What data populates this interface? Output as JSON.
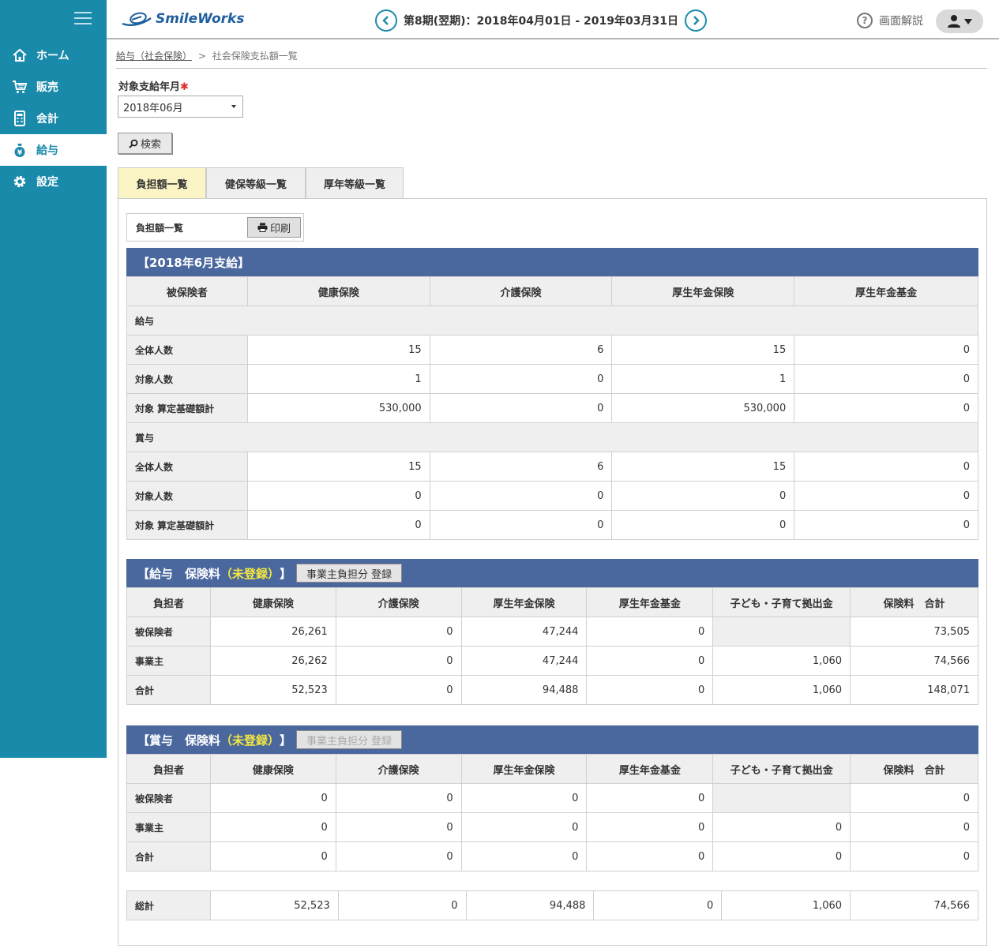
{
  "app": {
    "logo_text": "SmileWorks"
  },
  "sidebar": {
    "items": [
      {
        "label": "ホーム",
        "icon": "home-icon"
      },
      {
        "label": "販売",
        "icon": "cart-icon"
      },
      {
        "label": "会計",
        "icon": "calculator-icon"
      },
      {
        "label": "給与",
        "icon": "money-bag-icon",
        "active": true
      },
      {
        "label": "設定",
        "icon": "gear-icon"
      }
    ]
  },
  "header": {
    "period": "第8期(翌期)：2018年04月01日 - 2019年03月31日",
    "help_label": "画面解説"
  },
  "breadcrumb": {
    "parent": "給与（社会保険）",
    "separator": ">",
    "current": "社会保険支払額一覧"
  },
  "form": {
    "label": "対象支給年月",
    "required_mark": "✱",
    "selected_month": "2018年06月",
    "search_label": "検索"
  },
  "tabs": [
    {
      "label": "負担額一覧",
      "active": true
    },
    {
      "label": "健保等級一覧"
    },
    {
      "label": "厚年等級一覧"
    }
  ],
  "panel": {
    "title": "負担額一覧",
    "print_label": "印刷"
  },
  "summary": {
    "title": "【2018年6月支給】",
    "headers": [
      "被保険者",
      "健康保険",
      "介護保険",
      "厚生年金保険",
      "厚生年金基金"
    ],
    "groups": [
      {
        "name": "給与",
        "rows": [
          {
            "label": "全体人数",
            "values": [
              "15",
              "6",
              "15",
              "0"
            ]
          },
          {
            "label": "対象人数",
            "values": [
              "1",
              "0",
              "1",
              "0"
            ]
          },
          {
            "label": "対象 算定基礎額計",
            "values": [
              "530,000",
              "0",
              "530,000",
              "0"
            ]
          }
        ]
      },
      {
        "name": "賞与",
        "rows": [
          {
            "label": "全体人数",
            "values": [
              "15",
              "6",
              "15",
              "0"
            ]
          },
          {
            "label": "対象人数",
            "values": [
              "0",
              "0",
              "0",
              "0"
            ]
          },
          {
            "label": "対象 算定基礎額計",
            "values": [
              "0",
              "0",
              "0",
              "0"
            ]
          }
        ]
      }
    ]
  },
  "salary": {
    "title_prefix": "【給与　保険料",
    "title_unreg": "（未登録）",
    "title_suffix": "】",
    "register_label": "事業主負担分 登録",
    "headers": [
      "負担者",
      "健康保険",
      "介護保険",
      "厚生年金保険",
      "厚生年金基金",
      "子ども・子育て拠出金",
      "保険料　合計"
    ],
    "rows": [
      {
        "label": "被保険者",
        "values": [
          "26,261",
          "0",
          "47,244",
          "0",
          "",
          "73,505"
        ]
      },
      {
        "label": "事業主",
        "values": [
          "26,262",
          "0",
          "47,244",
          "0",
          "1,060",
          "74,566"
        ]
      },
      {
        "label": "合計",
        "values": [
          "52,523",
          "0",
          "94,488",
          "0",
          "1,060",
          "148,071"
        ]
      }
    ]
  },
  "bonus": {
    "title_prefix": "【賞与　保険料",
    "title_unreg": "（未登録）",
    "title_suffix": "】",
    "register_label": "事業主負担分 登録",
    "headers": [
      "負担者",
      "健康保険",
      "介護保険",
      "厚生年金保険",
      "厚生年金基金",
      "子ども・子育て拠出金",
      "保険料　合計"
    ],
    "rows": [
      {
        "label": "被保険者",
        "values": [
          "0",
          "0",
          "0",
          "0",
          "",
          "0"
        ]
      },
      {
        "label": "事業主",
        "values": [
          "0",
          "0",
          "0",
          "0",
          "0",
          "0"
        ]
      },
      {
        "label": "合計",
        "values": [
          "0",
          "0",
          "0",
          "0",
          "0",
          "0"
        ]
      }
    ]
  },
  "total": {
    "label": "総計",
    "values": [
      "52,523",
      "0",
      "94,488",
      "0",
      "1,060",
      "74,566"
    ]
  },
  "colors": {
    "sidebar": "#1a8aab",
    "section_header": "#4a679e",
    "unregistered": "#f6e83e",
    "active_tab": "#fbf4c5"
  }
}
